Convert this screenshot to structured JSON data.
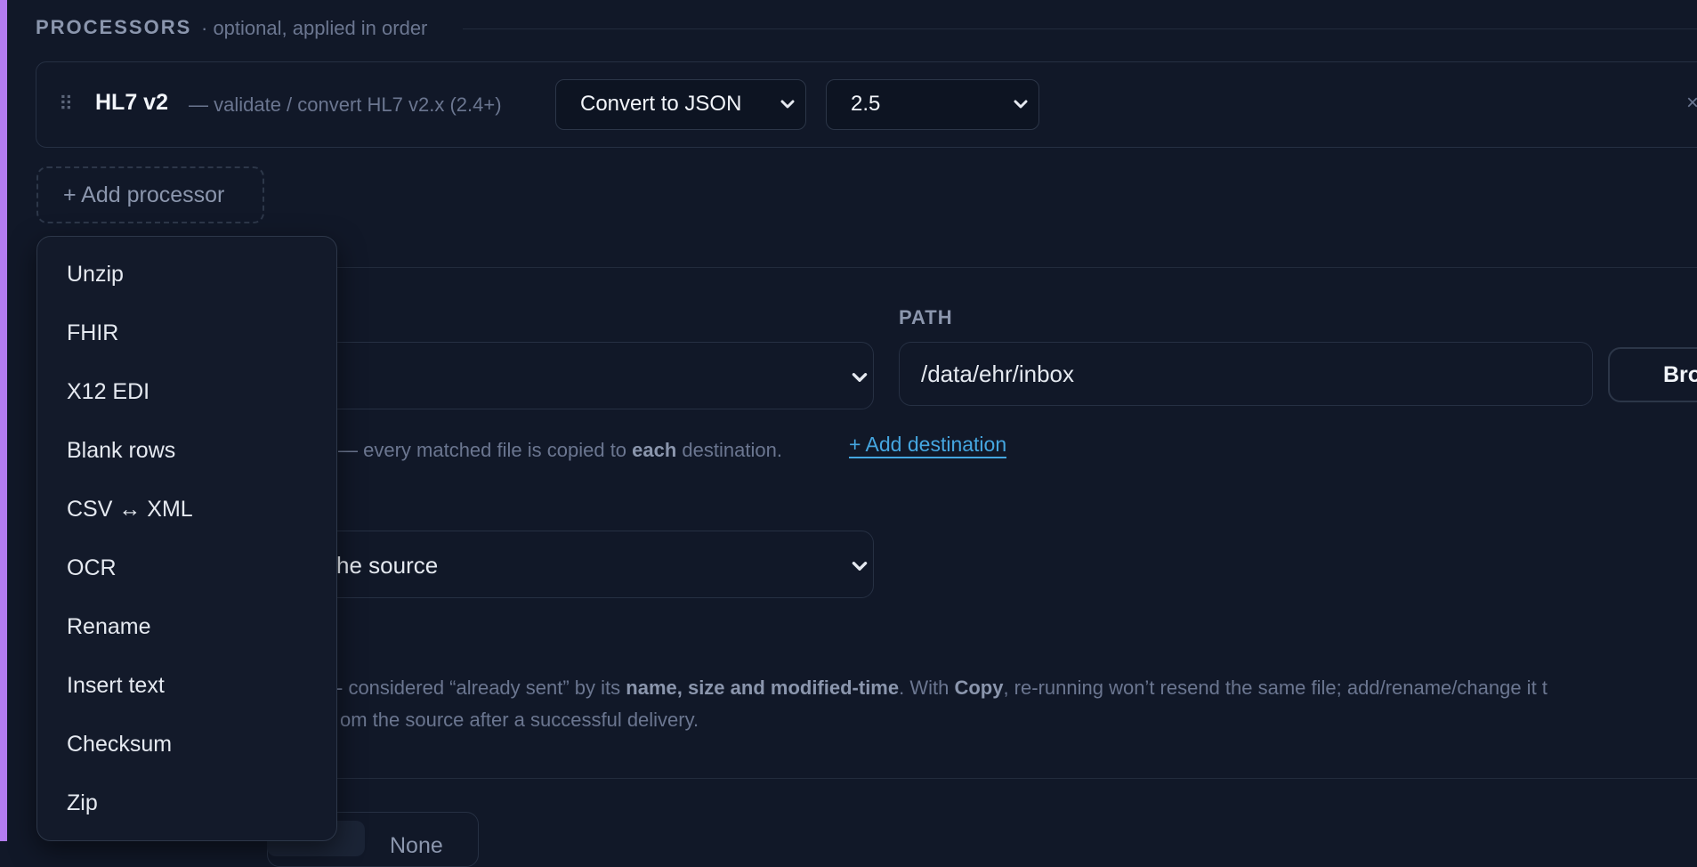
{
  "processors": {
    "title": "PROCESSORS",
    "subtitle": "· optional, applied in order",
    "item": {
      "name": "HL7 v2",
      "description": "— validate / convert HL7 v2.x (2.4+)",
      "action_select": "Convert to JSON",
      "version_select": "2.5"
    },
    "add_label": "+ Add processor",
    "menu": [
      "Unzip",
      "FHIR",
      "X12 EDI",
      "Blank rows",
      "CSV ↔ XML",
      "OCR",
      "Rename",
      "Insert text",
      "Checksum",
      "Zip"
    ]
  },
  "destination": {
    "path_label": "PATH",
    "path_value": "/data/ehr/inbox",
    "browse_label": "Browse",
    "note_pre": "— every matched file is copied to ",
    "note_bold": "each",
    "note_post": " destination.",
    "add_destination": "+ Add destination"
  },
  "after_select_text": "he source",
  "dedupe": {
    "pre": "- considered “already sent” by its ",
    "bold1": "name, size and modified-time",
    "mid": ". With ",
    "bold2": "Copy",
    "post": ", re-running won’t resend the same file; add/rename/change it t",
    "line2": "om the source after a successful delivery."
  },
  "tabs": {
    "none_label": "None"
  },
  "colors": {
    "background": "#111828",
    "accent_bar": "#b47cf0",
    "link": "#45a6e0"
  }
}
